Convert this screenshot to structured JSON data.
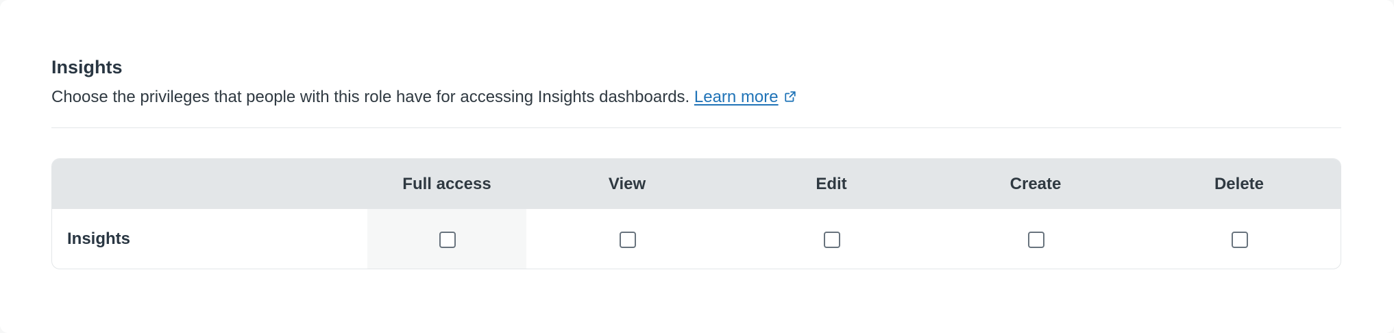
{
  "section": {
    "title": "Insights",
    "description": "Choose the privileges that people with this role have for accessing Insights dashboards.",
    "learn_more_label": "Learn more",
    "link_icon": "external-link-icon"
  },
  "table": {
    "columns": [
      "Full access",
      "View",
      "Edit",
      "Create",
      "Delete"
    ],
    "rows": [
      {
        "label": "Insights",
        "checked": [
          false,
          false,
          false,
          false,
          false
        ]
      }
    ]
  },
  "colors": {
    "link": "#1f73b7",
    "header_bg": "#e3e6e8",
    "text": "#2f3941",
    "checkbox_border": "#68737d"
  }
}
